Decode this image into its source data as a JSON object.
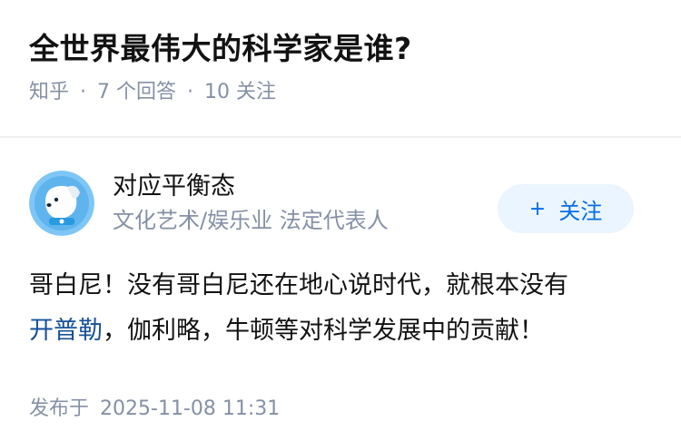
{
  "question": {
    "title": "全世界最伟大的科学家是谁?",
    "source": "知乎",
    "answers_count": "7 个回答",
    "followers_count": "10 关注"
  },
  "answer": {
    "author": {
      "name": "对应平衡态",
      "bio": "文化艺术/娱乐业 法定代表人",
      "avatar_icon": "dog-avatar-icon"
    },
    "follow_button": {
      "label": "关注",
      "icon": "plus-icon"
    },
    "content": {
      "part1": "哥白尼！没有哥白尼还在地心说时代，就根本没有",
      "link_text": "开普勒",
      "part2": "，伽利略，牛顿等对科学发展中的贡献！"
    },
    "published": {
      "label": "发布于",
      "time": "2025-11-08 11:31"
    }
  },
  "colors": {
    "title": "#121212",
    "meta": "#8590a6",
    "link": "#175199",
    "follow_bg": "#ebf5ff",
    "follow_text": "#056de8"
  }
}
